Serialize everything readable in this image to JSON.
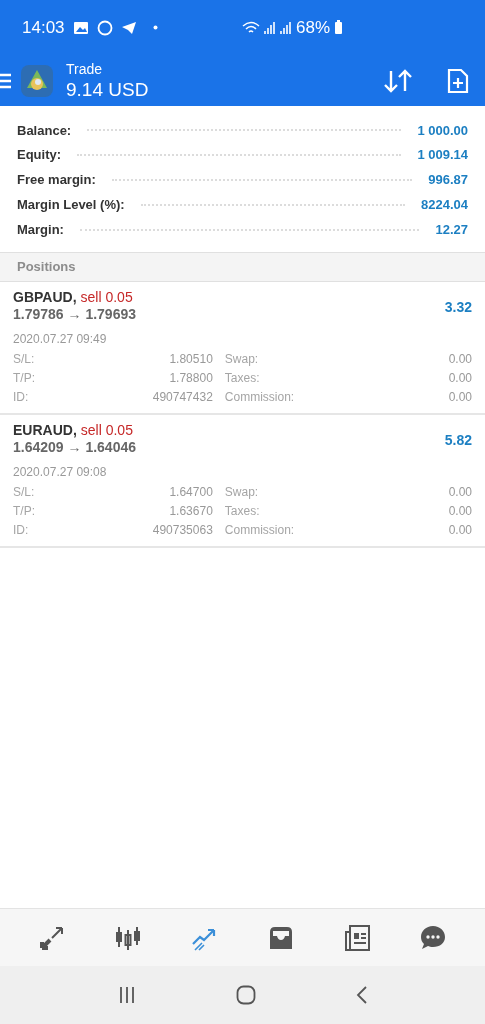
{
  "status_bar": {
    "time": "14:03",
    "battery": "68%"
  },
  "header": {
    "title": "Trade",
    "subtitle": "9.14 USD"
  },
  "summary": [
    {
      "label": "Balance:",
      "value": "1 000.00"
    },
    {
      "label": "Equity:",
      "value": "1 009.14"
    },
    {
      "label": "Free margin:",
      "value": "996.87"
    },
    {
      "label": "Margin Level (%):",
      "value": "8224.04"
    },
    {
      "label": "Margin:",
      "value": "12.27"
    }
  ],
  "positions_header": "Positions",
  "positions": [
    {
      "symbol": "GBPAUD,",
      "order": "sell 0.05",
      "prices": "1.79786 → 1.79693",
      "profit": "3.32",
      "time": "2020.07.27 09:49",
      "details": [
        [
          "S/L:",
          "1.80510",
          "Swap:",
          "0.00"
        ],
        [
          "T/P:",
          "1.78800",
          "Taxes:",
          "0.00"
        ],
        [
          "ID:",
          "490747432",
          "Commission:",
          "0.00"
        ]
      ]
    },
    {
      "symbol": "EURAUD,",
      "order": "sell 0.05",
      "prices": "1.64209 → 1.64046",
      "profit": "5.82",
      "time": "2020.07.27 09:08",
      "details": [
        [
          "S/L:",
          "1.64700",
          "Swap:",
          "0.00"
        ],
        [
          "T/P:",
          "1.63670",
          "Taxes:",
          "0.00"
        ],
        [
          "ID:",
          "490735063",
          "Commission:",
          "0.00"
        ]
      ]
    }
  ],
  "bottom_tabs": [
    {
      "kind": "quotes",
      "selected": false
    },
    {
      "kind": "chart",
      "selected": false
    },
    {
      "kind": "trade",
      "selected": true
    },
    {
      "kind": "history",
      "selected": false
    },
    {
      "kind": "news",
      "selected": false
    },
    {
      "kind": "chat",
      "selected": false
    }
  ]
}
